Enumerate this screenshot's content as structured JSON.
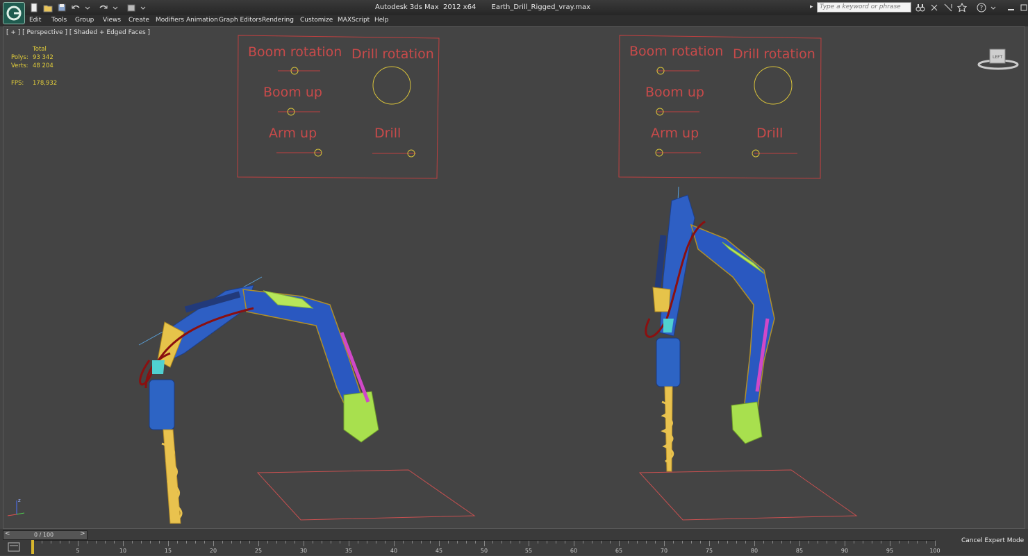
{
  "window": {
    "title": "Autodesk 3ds Max  2012 x64       Earth_Drill_Rigged_vray.max",
    "search_placeholder": "Type a keyword or phrase"
  },
  "menu": [
    "Edit",
    "Tools",
    "Group",
    "Views",
    "Create",
    "Modifiers",
    "Animation",
    "Graph Editors",
    "Rendering",
    "Customize",
    "MAXScript",
    "Help"
  ],
  "viewport": {
    "label": "[ + ] [ Perspective ] [ Shaded + Edged Faces ]",
    "stats": {
      "total_label": "Total",
      "polys_label": "Polys:",
      "polys_value": "93 342",
      "verts_label": "Verts:",
      "verts_value": "48 204",
      "fps_label": "FPS:",
      "fps_value": "178,932"
    },
    "viewcube_label": "LEFT",
    "control_panels": [
      {
        "boom_rotation": "Boom rotation",
        "drill_rotation": "Drill rotation",
        "boom_up": "Boom up",
        "arm_up": "Arm  up",
        "drill": "Drill"
      },
      {
        "boom_rotation": "Boom rotation",
        "drill_rotation": "Drill rotation",
        "boom_up": "Boom up",
        "arm_up": "Arm  up",
        "drill": "Drill"
      }
    ],
    "colors": {
      "panel_text": "#c84a4a",
      "panel_border": "#c04040",
      "slider_knob": "#d8c23a",
      "stat_text": "#e4cf3a"
    }
  },
  "timeline": {
    "current": "0 / 100",
    "prev_arrow": "<",
    "next_arrow": ">",
    "ticks": [
      "5",
      "10",
      "15",
      "20",
      "25",
      "30",
      "35",
      "40",
      "45",
      "50",
      "55",
      "60",
      "65",
      "70",
      "75",
      "80",
      "85",
      "90",
      "95",
      "100"
    ]
  },
  "status": {
    "cancel_expert": "Cancel Expert Mode"
  }
}
